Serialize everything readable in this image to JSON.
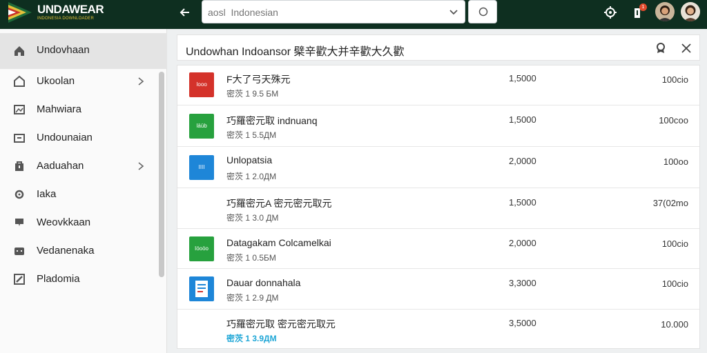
{
  "app": {
    "logo_text": "UNDAWEAR",
    "logo_sub": "INDONESIA DOWNLOADER"
  },
  "search": {
    "value": "",
    "placeholder": "aosl  Indonesian"
  },
  "icons": {
    "back": "arrow-left-icon",
    "chevron": "chevron-down-icon",
    "search": "circle-search-icon",
    "settings": "gear-icon",
    "notifications": "bell-icon",
    "close": "close-icon",
    "badge_hint": "filter-badge-icon"
  },
  "notifications_badge": "1",
  "sidebar": {
    "items": [
      {
        "label": "Undovhaan",
        "icon": "home-icon",
        "active": true,
        "chevron": false
      },
      {
        "label": "Ukoolan",
        "icon": "house-arrow-icon",
        "active": false,
        "chevron": true
      },
      {
        "label": "Mahwiara",
        "icon": "image-icon",
        "active": false,
        "chevron": false
      },
      {
        "label": "Undounaian",
        "icon": "folder-icon",
        "active": false,
        "chevron": false
      },
      {
        "label": "Aaduahan",
        "icon": "bag-icon",
        "active": false,
        "chevron": true
      },
      {
        "label": "Iaka",
        "icon": "gear-icon",
        "active": false,
        "chevron": false
      },
      {
        "label": "Weovkkaan",
        "icon": "download-icon",
        "active": false,
        "chevron": false
      },
      {
        "label": "Vedanenaka",
        "icon": "archive-icon",
        "active": false,
        "chevron": false
      },
      {
        "label": "Pladomia",
        "icon": "edit-icon",
        "active": false,
        "chevron": false
      }
    ]
  },
  "panel": {
    "title": "Undowhan Indoansor 檗辛歡大并辛歡大久歡"
  },
  "rows": [
    {
      "name": "F大了弓天殊元",
      "size": "密茨 1 9.5 БM",
      "value": "1,5000",
      "percent": "100cio",
      "thumb_color": "#d4322a",
      "thumb_text": "Iooo",
      "thumb_kind": "block",
      "highlight": false
    },
    {
      "name": "巧羅密元取 indnuanq",
      "size": "密茨 1 5.5ДM",
      "value": "1,5000",
      "percent": "100соо",
      "thumb_color": "#27a13e",
      "thumb_text": "Iāüb",
      "thumb_kind": "block",
      "highlight": false
    },
    {
      "name": "Unlopatsia",
      "size": "密茨 1 2.0ДM",
      "value": "2,0000",
      "percent": "100oo",
      "thumb_color": "#1e86d8",
      "thumb_text": "IIII",
      "thumb_kind": "block",
      "highlight": false
    },
    {
      "name": "巧羅密元A  密元密元取元",
      "size": "密茨 1 3.0 ДM",
      "value": "1,5000",
      "percent": "37(02mo",
      "thumb_color": "",
      "thumb_text": "",
      "thumb_kind": "none",
      "highlight": false
    },
    {
      "name": "Datagakam Colcamelkai",
      "size": "密茨 1 0.5БM",
      "value": "2,0000",
      "percent": "100cio",
      "thumb_color": "#27a13e",
      "thumb_text": "Iöoöo",
      "thumb_kind": "block",
      "highlight": false
    },
    {
      "name": "Dauar donnahala",
      "size": "密茨 1 2.9 ДM",
      "value": "3,3000",
      "percent": "100cio",
      "thumb_color": "#1e86d8",
      "thumb_text": "",
      "thumb_kind": "document",
      "highlight": false
    },
    {
      "name": "巧羅密元取  密元密元取元",
      "size": "密茨 1 3.9ДM",
      "value": "3,5000",
      "percent": "10.000",
      "thumb_color": "",
      "thumb_text": "",
      "thumb_kind": "none",
      "highlight": true
    }
  ]
}
